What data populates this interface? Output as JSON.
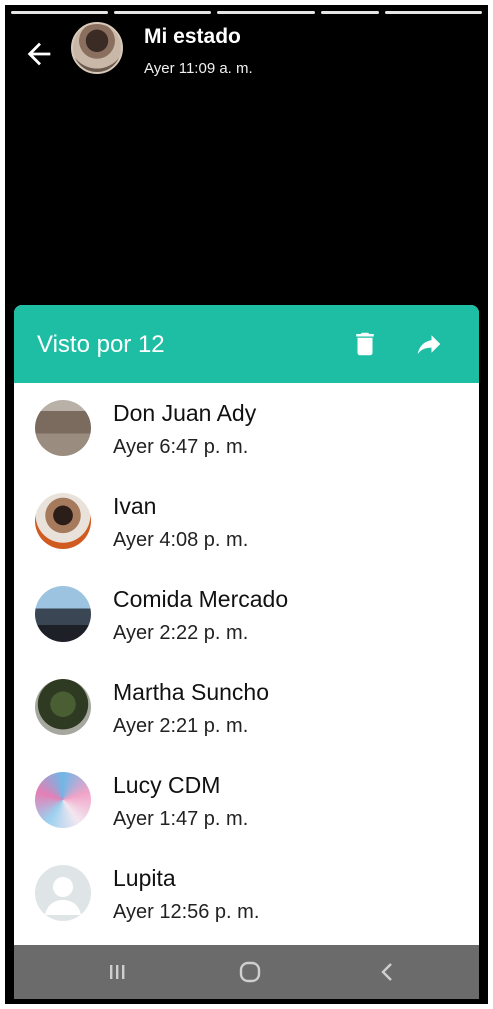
{
  "header": {
    "title": "Mi estado",
    "subtitle": "Ayer 11:09 a. m."
  },
  "viewers_panel": {
    "title": "Visto por 12",
    "accent_color": "#1ebea5"
  },
  "viewers": [
    {
      "name": "Don Juan Ady",
      "time": "Ayer 6:47 p. m."
    },
    {
      "name": "Ivan",
      "time": "Ayer 4:08 p. m."
    },
    {
      "name": "Comida Mercado",
      "time": "Ayer 2:22 p. m."
    },
    {
      "name": "Martha Suncho",
      "time": "Ayer 2:21 p. m."
    },
    {
      "name": "Lucy CDM",
      "time": "Ayer 1:47 p. m."
    },
    {
      "name": "Lupita",
      "time": "Ayer 12:56 p. m."
    }
  ],
  "icons": [
    "back-arrow-icon",
    "trash-icon",
    "share-forward-icon",
    "recents-icon",
    "home-icon",
    "nav-back-icon"
  ]
}
